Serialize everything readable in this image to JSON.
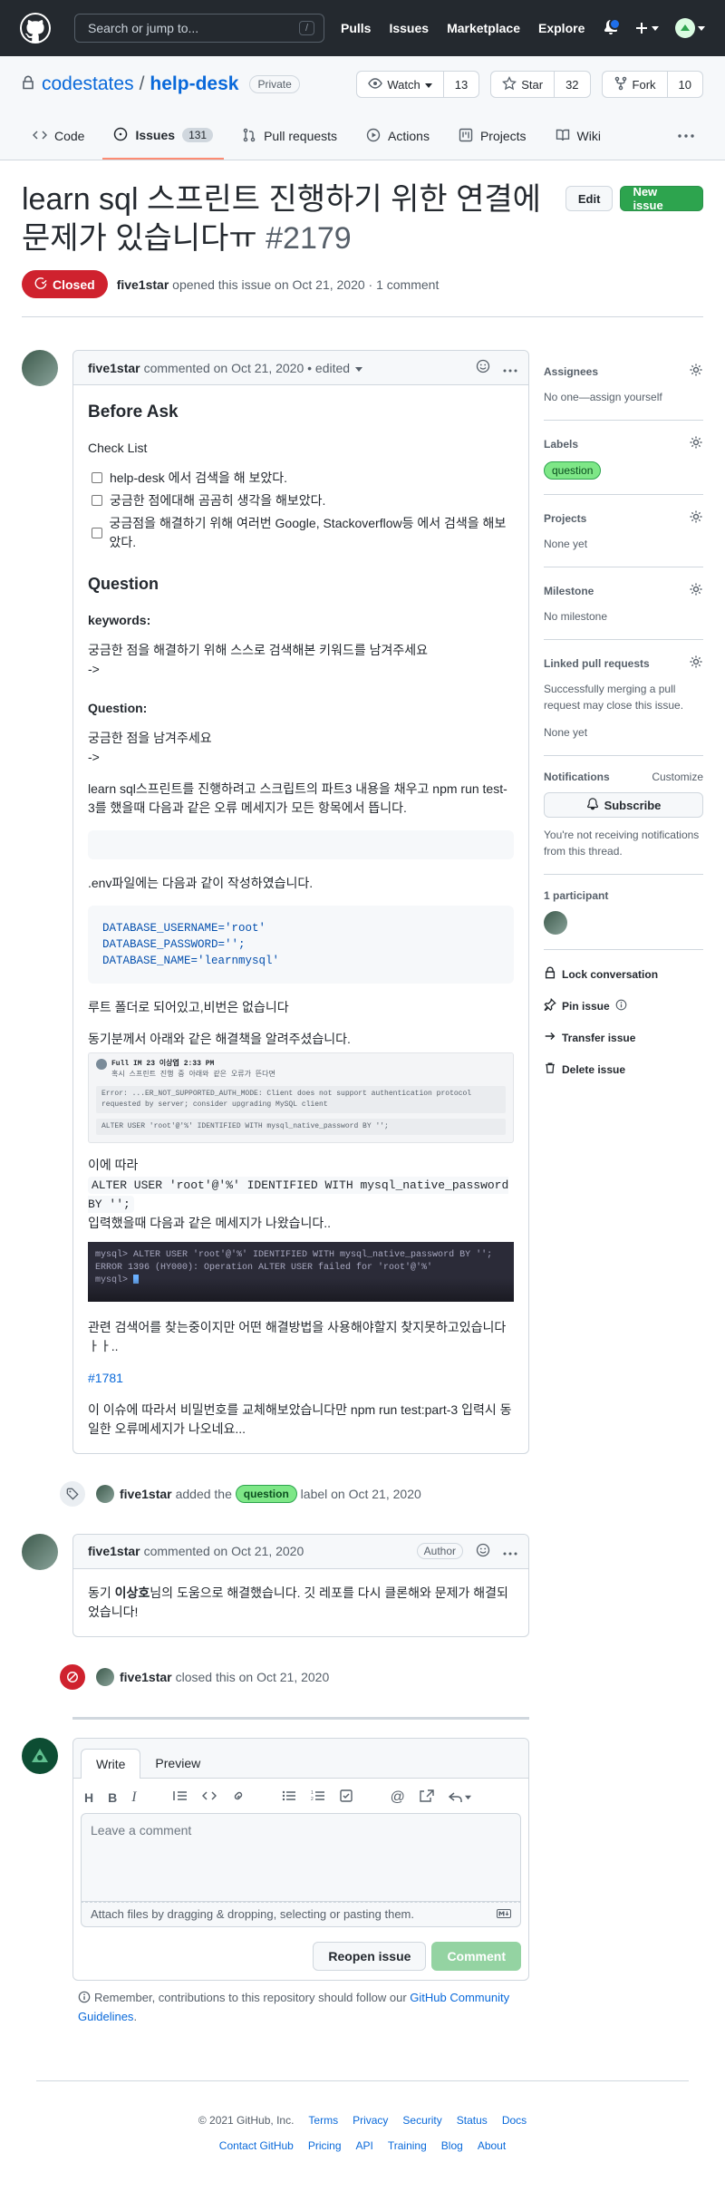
{
  "header": {
    "search_placeholder": "Search or jump to...",
    "search_key": "/",
    "nav": [
      "Pulls",
      "Issues",
      "Marketplace",
      "Explore"
    ]
  },
  "repo": {
    "owner": "codestates",
    "separator": "/",
    "name": "help-desk",
    "visibility": "Private",
    "watch_label": "Watch",
    "watch_count": "13",
    "star_label": "Star",
    "star_count": "32",
    "fork_label": "Fork",
    "fork_count": "10",
    "tabs": [
      {
        "label": "Code"
      },
      {
        "label": "Issues",
        "count": "131"
      },
      {
        "label": "Pull requests"
      },
      {
        "label": "Actions"
      },
      {
        "label": "Projects"
      },
      {
        "label": "Wiki"
      }
    ]
  },
  "issue": {
    "title": "learn sql 스프린트 진행하기 위한 연결에 문제가 있습니다ㅠ",
    "number": "#2179",
    "edit_label": "Edit",
    "new_issue_label": "New issue",
    "state": "Closed",
    "author": "five1star",
    "meta_text": "opened this issue on Oct 21, 2020 · 1 comment"
  },
  "comment1": {
    "author": "five1star",
    "meta": "commented on Oct 21, 2020 • edited",
    "h_before_ask": "Before Ask",
    "h_checklist": "Check List",
    "tasks": [
      "help-desk 에서 검색을 해 보았다.",
      "궁금한 점에대해 곰곰히 생각을 해보았다.",
      "궁금점을 해결하기 위해 여러번 Google, Stackoverflow등 에서 검색을 해보았다."
    ],
    "h_question": "Question",
    "h_keywords": "keywords:",
    "keywords_text": "궁금한 점을 해결하기 위해 스스로 검색해본 키워드를 남겨주세요",
    "arrow1": "->",
    "h_question2": "Question:",
    "question_text": "궁금한 점을 남겨주세요",
    "arrow2": "->",
    "para1": "learn sql스프린트를 진행하려고 스크립트의 파트3 내용을 채우고 npm run test-3를 했을때 다음과 같은 오류 메세지가 모든 항목에서 뜹니다.",
    "para2": ".env파일에는 다음과 같이 작성하였습니다.",
    "code_lines": [
      "DATABASE_USERNAME='root'",
      "DATABASE_PASSWORD='';",
      "DATABASE_NAME='learnmysql'"
    ],
    "para3": "루트 폴더로 되어있고,비번은 없습니다",
    "para4": "동기분께서 아래와 같은 해결책을 알려주셨습니다.",
    "shot1_head": "Full IM 23 이상엽  2:33 PM",
    "shot1_sub": "혹시 스프린트 진행 중 아래와 같은 오류가 뜬다면",
    "shot1_line1": "Error: ...ER_NOT_SUPPORTED_AUTH_MODE: Client does not support authentication protocol requested by server; consider upgrading MySQL client",
    "shot1_line2": "ALTER USER 'root'@'%' IDENTIFIED WITH mysql_native_password BY '';",
    "para5": "이에 따라",
    "inline_code": "ALTER USER 'root'@'%' IDENTIFIED WITH mysql_native_password BY '';",
    "para6": "입력했을때 다음과 같은 메세지가 나왔습니다..",
    "shot2_lines": [
      "mysql> ALTER USER 'root'@'%' IDENTIFIED WITH mysql_native_password BY '';",
      "ERROR 1396 (HY000): Operation ALTER USER failed for 'root'@'%'",
      "mysql> "
    ],
    "para7": "관련 검색어를 찾는중이지만 어떤 해결방법을 사용해야할지 찾지못하고있습니다ㅏㅏ..",
    "link": "#1781",
    "para8": "이 이슈에 따라서 비밀번호를 교체해보았습니다만 npm run test:part-3 입력시 동일한 오류메세지가 나오네요..."
  },
  "event_label": {
    "author": "five1star",
    "before": "added the",
    "label": "question",
    "after": "label on Oct 21, 2020"
  },
  "comment2": {
    "author": "five1star",
    "meta": "commented on Oct 21, 2020",
    "badge": "Author",
    "body_pre": "동기 ",
    "body_bold": "이상호",
    "body_post": "님의 도움으로 해결했습니다. 깃 레포를 다시 클론해와 문제가 해결되었습니다!"
  },
  "event_closed": {
    "author": "five1star",
    "text": "closed this on Oct 21, 2020"
  },
  "form": {
    "tab_write": "Write",
    "tab_preview": "Preview",
    "placeholder": "Leave a comment",
    "attach_text": "Attach files by dragging & dropping, selecting or pasting them.",
    "reopen_label": "Reopen issue",
    "comment_label": "Comment",
    "note_pre": "Remember, contributions to this repository should follow our ",
    "note_link": "GitHub Community Guidelines",
    "note_post": "."
  },
  "sidebar": {
    "assignees_title": "Assignees",
    "assignees_text": "No one—assign yourself",
    "labels_title": "Labels",
    "label": "question",
    "projects_title": "Projects",
    "projects_text": "None yet",
    "milestone_title": "Milestone",
    "milestone_text": "No milestone",
    "linked_title": "Linked pull requests",
    "linked_text": "Successfully merging a pull request may close this issue.",
    "linked_none": "None yet",
    "notifications_title": "Notifications",
    "customize": "Customize",
    "subscribe": "Subscribe",
    "notif_text": "You're not receiving notifications from this thread.",
    "participants": "1 participant",
    "lock": "Lock conversation",
    "pin": "Pin issue",
    "transfer": "Transfer issue",
    "delete": "Delete issue"
  },
  "footer": {
    "copyright": "© 2021 GitHub, Inc.",
    "row1": [
      "Terms",
      "Privacy",
      "Security",
      "Status",
      "Docs"
    ],
    "row2": [
      "Contact GitHub",
      "Pricing",
      "API",
      "Training",
      "Blog",
      "About"
    ]
  },
  "colors": {
    "header_bg": "#24292f",
    "closed_red": "#cf222e",
    "green": "#2da44e",
    "link": "#0969da",
    "label_green": "#7ee787"
  }
}
